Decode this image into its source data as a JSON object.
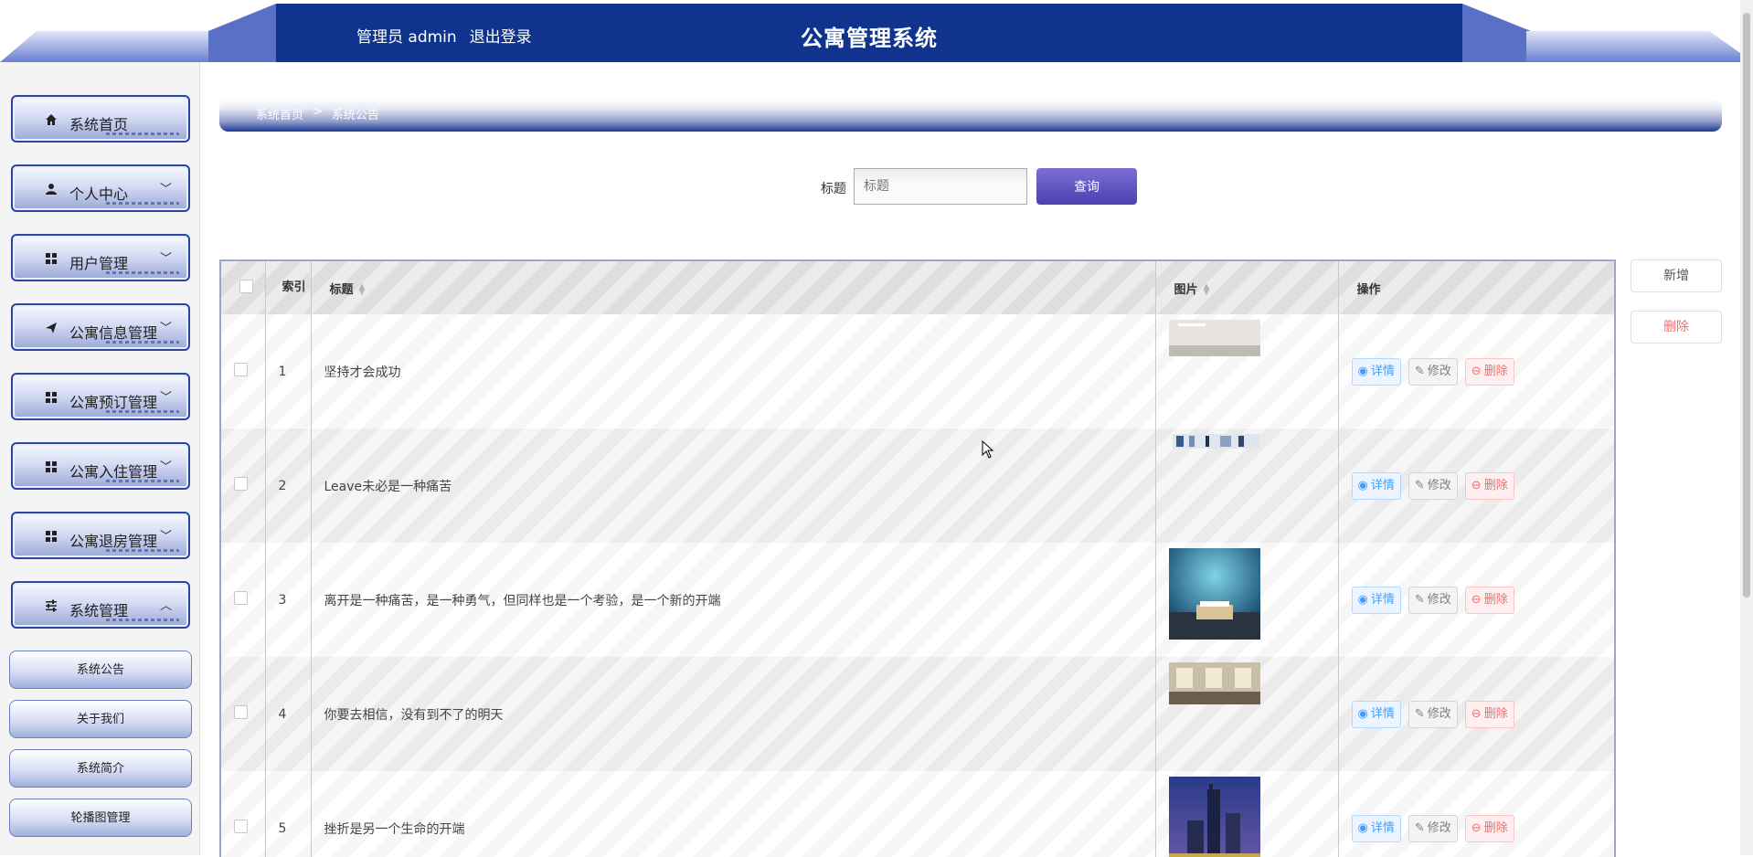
{
  "header": {
    "user_role": "管理员 admin",
    "logout": "退出登录",
    "title": "公寓管理系统"
  },
  "sidebar": {
    "items": [
      {
        "label": "系统首页",
        "icon": "home-icon",
        "has_chevron": false
      },
      {
        "label": "个人中心",
        "icon": "user-icon",
        "has_chevron": true,
        "chevron": "﹀"
      },
      {
        "label": "用户管理",
        "icon": "grid-icon",
        "has_chevron": true,
        "chevron": "﹀"
      },
      {
        "label": "公寓信息管理",
        "icon": "send-icon",
        "has_chevron": true,
        "chevron": "﹀"
      },
      {
        "label": "公寓预订管理",
        "icon": "grid-icon",
        "has_chevron": true,
        "chevron": "﹀"
      },
      {
        "label": "公寓入住管理",
        "icon": "grid-icon",
        "has_chevron": true,
        "chevron": "﹀"
      },
      {
        "label": "公寓退房管理",
        "icon": "grid-icon",
        "has_chevron": true,
        "chevron": "﹀"
      },
      {
        "label": "系统管理",
        "icon": "sliders-icon",
        "has_chevron": true,
        "chevron": "︿"
      }
    ],
    "subitems": [
      "系统公告",
      "关于我们",
      "系统简介",
      "轮播图管理"
    ]
  },
  "breadcrumb": {
    "home": "系统首页",
    "sep": ">",
    "current": "系统公告"
  },
  "search": {
    "label": "标题",
    "placeholder": "标题",
    "value": "",
    "button": "查询"
  },
  "actions": {
    "add": "新增",
    "delete": "删除"
  },
  "table": {
    "headers": {
      "index": "索引",
      "title": "标题",
      "image": "图片",
      "ops": "操作"
    },
    "rows": [
      {
        "index": "1",
        "title": "坚持才会成功"
      },
      {
        "index": "2",
        "title": "Leave未必是一种痛苦"
      },
      {
        "index": "3",
        "title": "离开是一种痛苦，是一种勇气，但同样也是一个考验，是一个新的开端"
      },
      {
        "index": "4",
        "title": "你要去相信，没有到不了的明天"
      },
      {
        "index": "5",
        "title": "挫折是另一个生命的开端"
      }
    ],
    "op_labels": {
      "view": "详情",
      "edit": "修改",
      "delete": "删除"
    }
  },
  "colors": {
    "header_bg": "#10348e",
    "accent": "#2b45a3",
    "search_btn": "#5a4dbf"
  }
}
